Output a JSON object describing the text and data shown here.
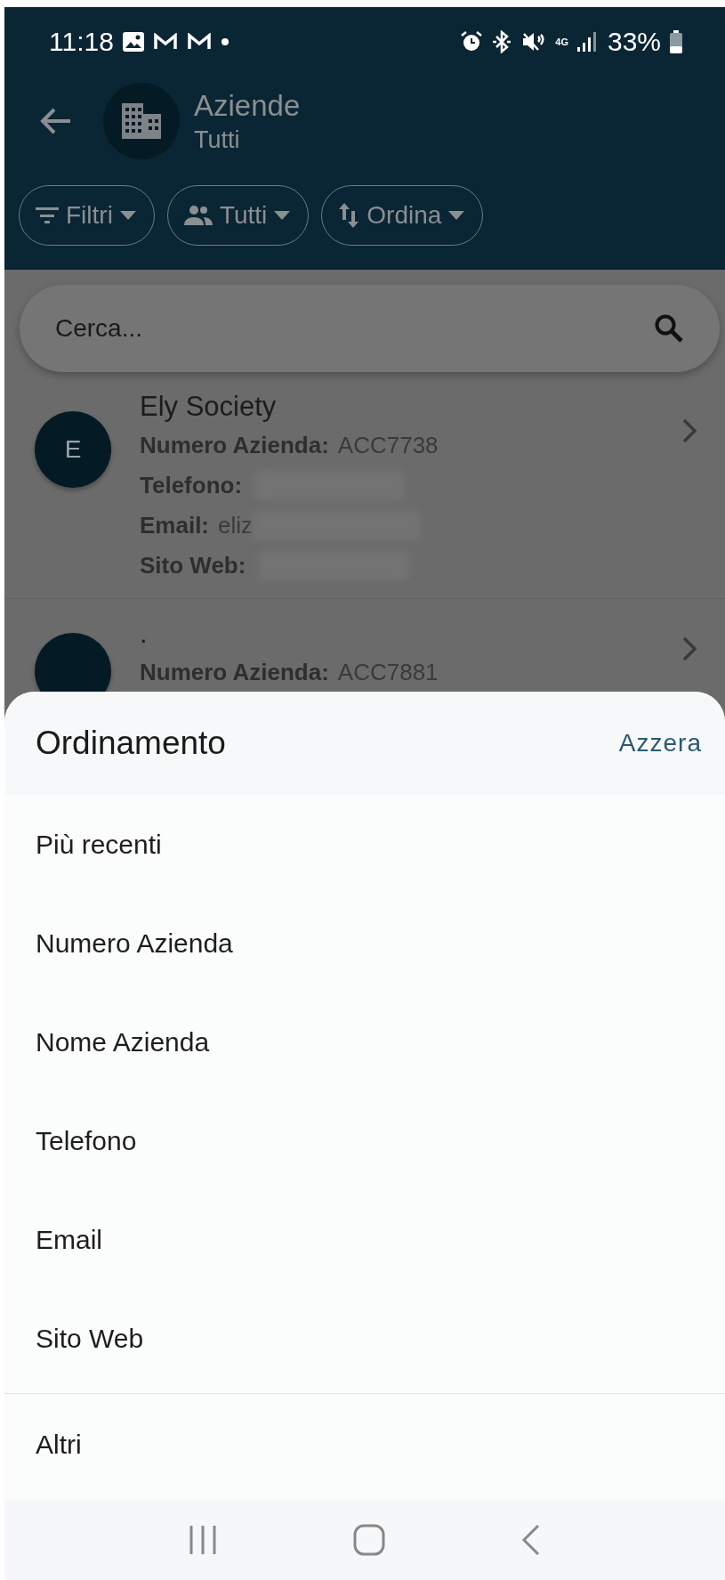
{
  "status_bar": {
    "time": "11:18",
    "network": "4G",
    "battery": "33%"
  },
  "header": {
    "title": "Aziende",
    "subtitle": "Tutti"
  },
  "chips": [
    {
      "label": "Filtri"
    },
    {
      "label": "Tutti"
    },
    {
      "label": "Ordina"
    }
  ],
  "search": {
    "placeholder": "Cerca..."
  },
  "companies": [
    {
      "initial": "E",
      "name": "Ely Society",
      "fields": [
        {
          "label": "Numero Azienda:",
          "value": "ACC7738"
        },
        {
          "label": "Telefono:",
          "redacted": true
        },
        {
          "label": "Email:",
          "value": "eliz",
          "redacted": true
        },
        {
          "label": "Sito Web:",
          "redacted": true
        }
      ]
    },
    {
      "name": ".",
      "fields": [
        {
          "label": "Numero Azienda:",
          "value": "ACC7881"
        }
      ]
    }
  ],
  "sort_sheet": {
    "title": "Ordinamento",
    "reset": "Azzera",
    "options": [
      {
        "label": "Più recenti",
        "selected": false
      },
      {
        "label": "Numero Azienda",
        "selected": false
      },
      {
        "label": "Nome Azienda",
        "selected": false
      },
      {
        "label": "Telefono",
        "selected": false
      },
      {
        "label": "Email",
        "selected": false
      },
      {
        "label": "Sito Web",
        "selected": false
      }
    ],
    "more": "Altri"
  }
}
